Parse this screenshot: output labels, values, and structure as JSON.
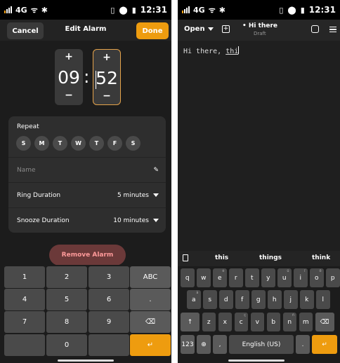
{
  "left": {
    "status": {
      "network": "4G",
      "time": "12:31"
    },
    "header": {
      "cancel": "Cancel",
      "title": "Edit Alarm",
      "done": "Done"
    },
    "time": {
      "hours": "09",
      "separator": ":",
      "minutes": "52",
      "plus": "+",
      "minus": "−"
    },
    "repeat": {
      "label": "Repeat",
      "days": [
        "S",
        "M",
        "T",
        "W",
        "T",
        "F",
        "S"
      ]
    },
    "name": {
      "placeholder": "Name"
    },
    "ring": {
      "label": "Ring Duration",
      "value": "5 minutes"
    },
    "snooze": {
      "label": "Snooze Duration",
      "value": "10 minutes"
    },
    "remove": "Remove Alarm",
    "keypad": [
      "1",
      "2",
      "3",
      "ABC",
      "4",
      "5",
      "6",
      ".",
      "7",
      "8",
      "9",
      "⌫",
      "",
      "0",
      "",
      "↵"
    ]
  },
  "right": {
    "status": {
      "network": "4G",
      "time": "12:31"
    },
    "header": {
      "open": "Open",
      "title": "• Hi there",
      "subtitle": "Draft"
    },
    "editor": {
      "text": "Hi there, ",
      "word": "thi"
    },
    "suggestions": [
      "this",
      "things",
      "think"
    ],
    "rows": [
      [
        {
          "k": "q"
        },
        {
          "k": "w"
        },
        {
          "k": "e",
          "s": "è"
        },
        {
          "k": "r"
        },
        {
          "k": "t"
        },
        {
          "k": "y"
        },
        {
          "k": "u",
          "s": "ü"
        },
        {
          "k": "i",
          "s": "ï"
        },
        {
          "k": "o",
          "s": "ö"
        },
        {
          "k": "p"
        }
      ],
      [
        {
          "k": "a",
          "s": "à"
        },
        {
          "k": "s"
        },
        {
          "k": "d"
        },
        {
          "k": "f"
        },
        {
          "k": "g"
        },
        {
          "k": "h"
        },
        {
          "k": "j"
        },
        {
          "k": "k"
        },
        {
          "k": "l"
        }
      ],
      [
        {
          "k": "↑"
        },
        {
          "k": "z"
        },
        {
          "k": "x"
        },
        {
          "k": "c",
          "s": "ç"
        },
        {
          "k": "v"
        },
        {
          "k": "b"
        },
        {
          "k": "n",
          "s": "ñ"
        },
        {
          "k": "m"
        },
        {
          "k": "⌫"
        }
      ]
    ],
    "bottom": {
      "num": "123",
      "comma": ",",
      "space": "English (US)",
      "period": "."
    }
  }
}
